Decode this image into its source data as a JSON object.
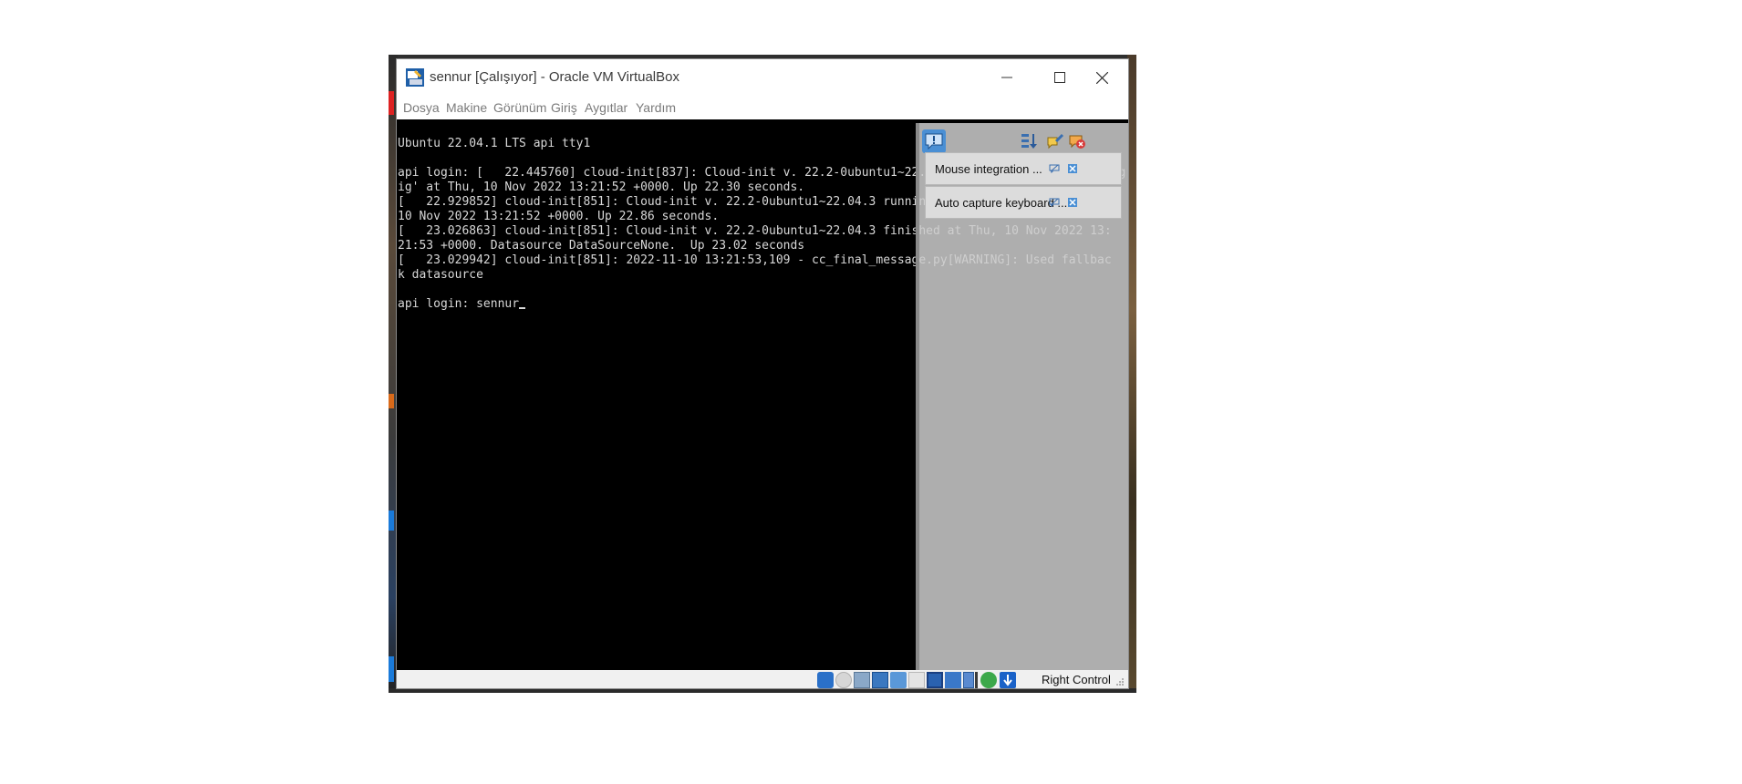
{
  "window": {
    "title": "sennur [Çalışıyor] - Oracle VM VirtualBox",
    "app_icon": "virtualbox-icon"
  },
  "menu": [
    "Dosya",
    "Makine",
    "Görünüm",
    "Giriş",
    "Aygıtlar",
    "Yardım"
  ],
  "console": {
    "lines": [
      "Ubuntu 22.04.1 LTS api tty1",
      "",
      "api login: [   22.445760] cloud-init[837]: Cloud-init v. 22.2-0ubuntu1~22.04.3 running 'modules:config",
      "ig' at Thu, 10 Nov 2022 13:21:52 +0000. Up 22.30 seconds.",
      "[   22.929852] cloud-init[851]: Cloud-init v. 22.2-0ubuntu1~22.04.3 running 'modules:final' at Thu,",
      "10 Nov 2022 13:21:52 +0000. Up 22.86 seconds.",
      "[   23.026863] cloud-init[851]: Cloud-init v. 22.2-0ubuntu1~22.04.3 finished at Thu, 10 Nov 2022 13:",
      "21:53 +0000. Datasource DataSourceNone.  Up 23.02 seconds",
      "[   23.029942] cloud-init[851]: 2022-11-10 13:21:53,109 - cc_final_message.py[WARNING]: Used fallbac",
      "k datasource",
      "",
      "api login: sennur"
    ]
  },
  "notifications": {
    "items": [
      {
        "label": "Mouse integration ..."
      },
      {
        "label": "Auto capture keyboard ..."
      }
    ],
    "tool_icons": [
      "notification-icon",
      "sort-icon",
      "ignore-icon",
      "clear-all-icon"
    ]
  },
  "statusbar": {
    "host_key": "Right Control",
    "icons": [
      "hard-disk-icon",
      "optical-drive-icon",
      "audio-icon",
      "network-icon",
      "usb-icon",
      "shared-folders-icon",
      "display-icon",
      "recording-icon",
      "video-capture-icon",
      "virtualization-icon",
      "cpu-icon",
      "keyboard-capture-icon"
    ]
  }
}
